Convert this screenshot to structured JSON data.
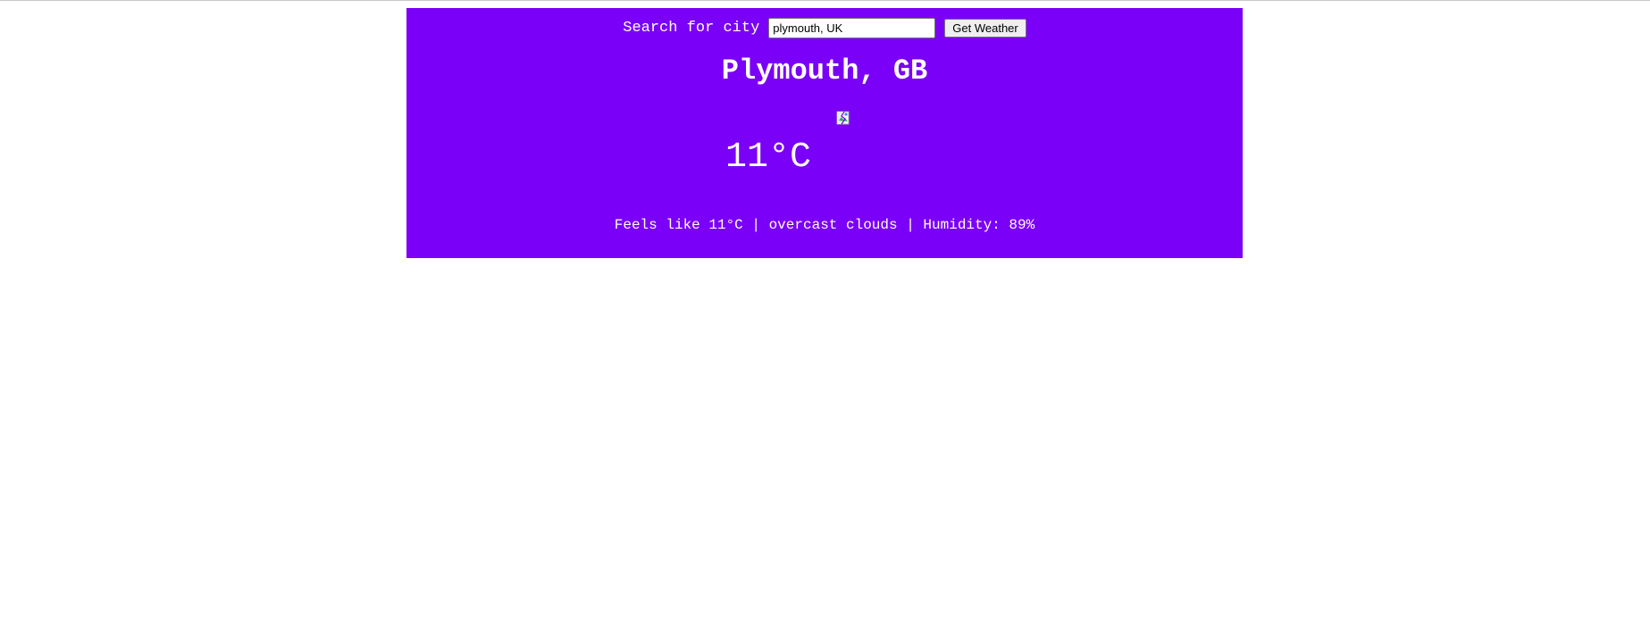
{
  "search": {
    "label": "Search for city",
    "value": "plymouth, UK",
    "button_label": "Get Weather"
  },
  "weather": {
    "city": "Plymouth, GB",
    "icon": "broken-image-icon",
    "temperature": "11°C",
    "details": "Feels like 11°C | overcast clouds | Humidity: 89%"
  },
  "colors": {
    "card_background": "#7b00f7",
    "text": "#ffffff"
  }
}
